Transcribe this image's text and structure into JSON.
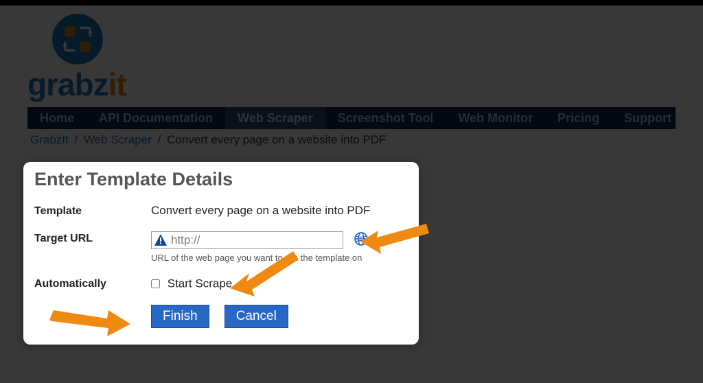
{
  "logo": {
    "text_a": "grabz",
    "text_b": "it"
  },
  "nav": {
    "items": [
      {
        "label": "Home"
      },
      {
        "label": "API Documentation"
      },
      {
        "label": "Web Scraper"
      },
      {
        "label": "Screenshot Tool"
      },
      {
        "label": "Web Monitor"
      },
      {
        "label": "Pricing"
      },
      {
        "label": "Support"
      }
    ]
  },
  "breadcrumb": {
    "a": "GrabzIt",
    "b": "Web Scraper",
    "c": "Convert every page on a website into PDF"
  },
  "modal": {
    "title": "Enter Template Details",
    "template_label": "Template",
    "template_value": "Convert every page on a website into PDF",
    "url_label": "Target URL",
    "url_value": "http://",
    "url_hint": "URL of the web page you want to run the template on",
    "auto_label": "Automatically",
    "auto_checkbox_label": "Start Scrape",
    "finish": "Finish",
    "cancel": "Cancel"
  }
}
